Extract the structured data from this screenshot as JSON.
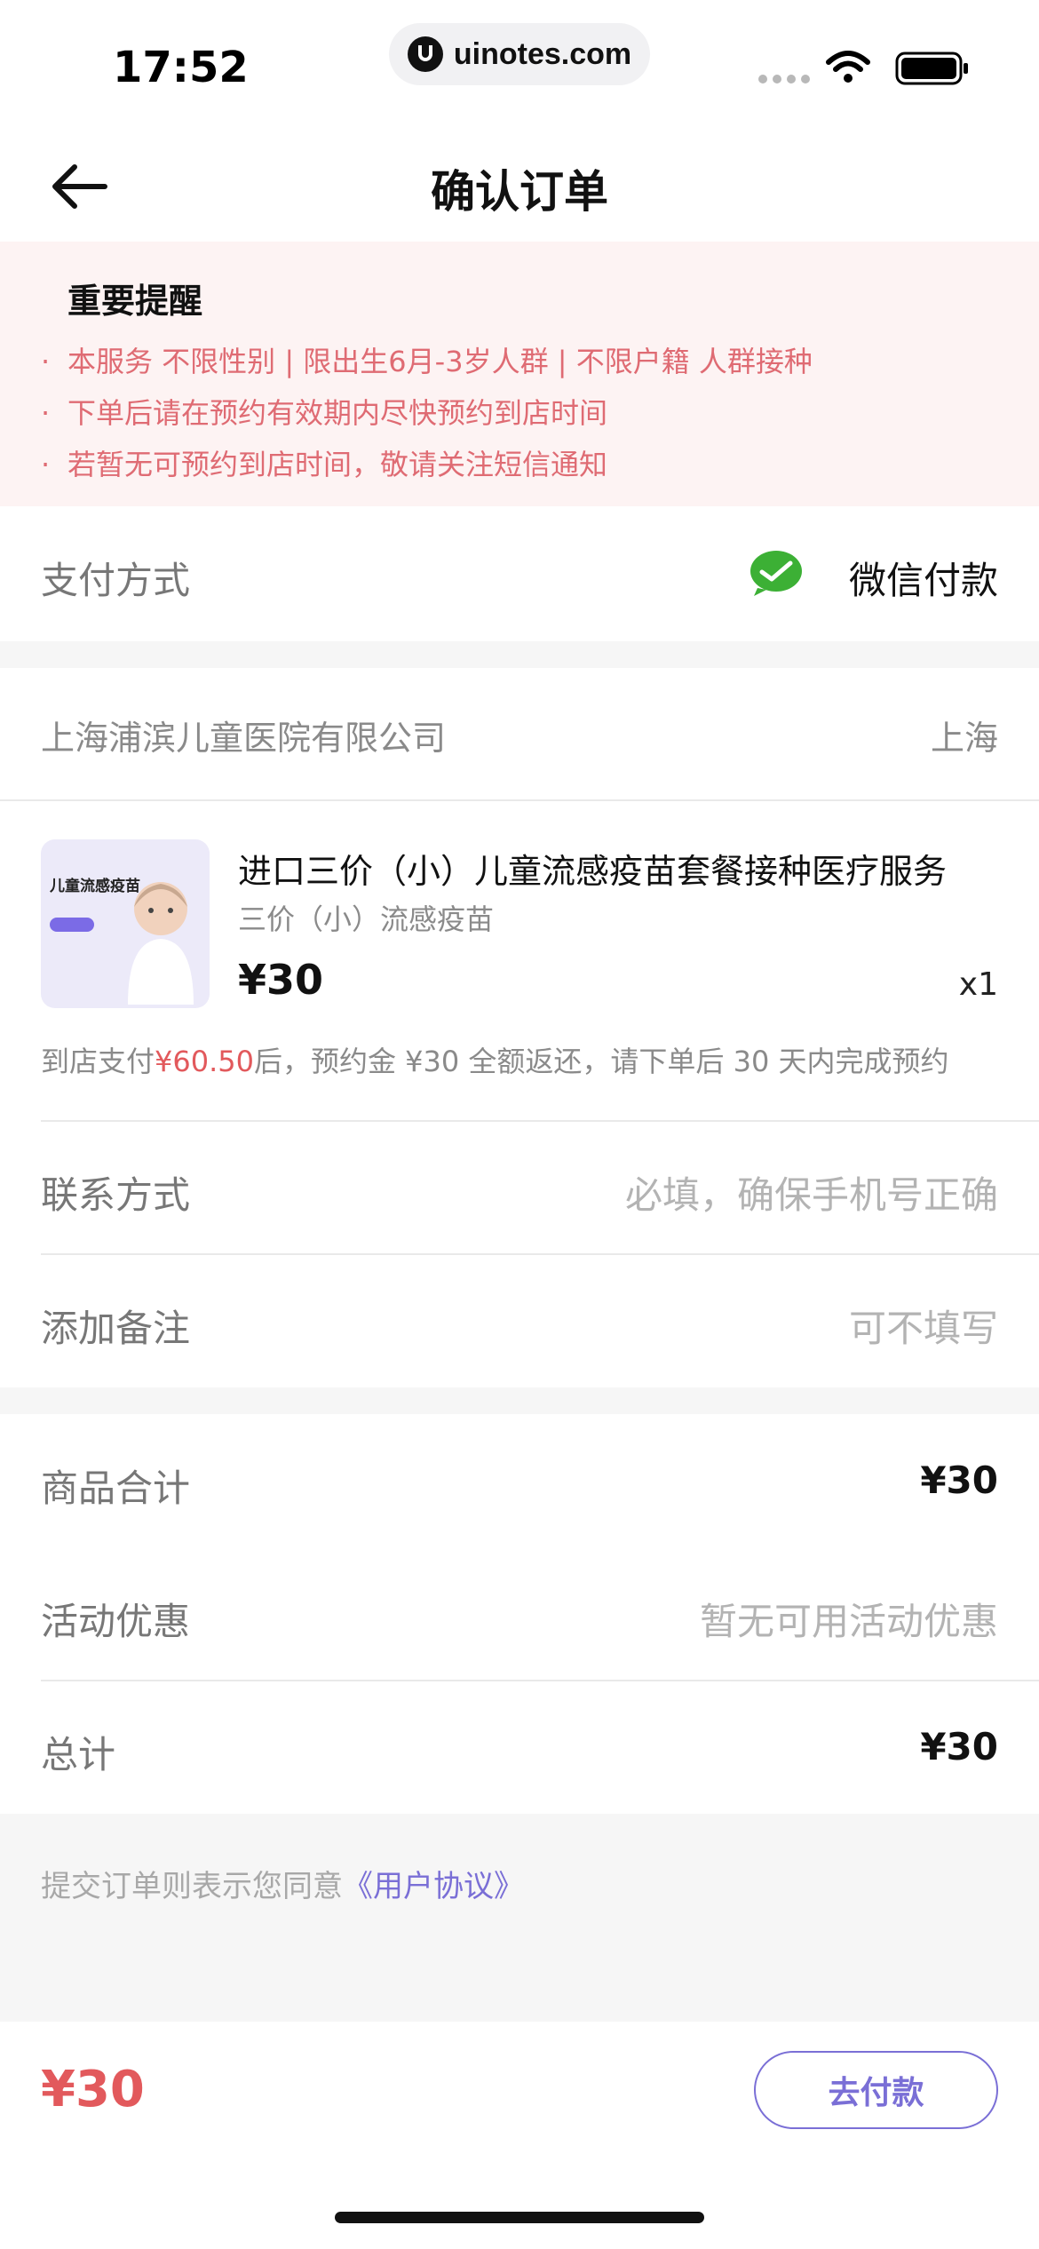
{
  "status_bar": {
    "time": "17:52",
    "url": "uinotes.com"
  },
  "nav": {
    "title": "确认订单",
    "back_icon": "arrow-left-icon"
  },
  "notice": {
    "title": "重要提醒",
    "lines": [
      "本服务 不限性别 | 限出生6月-3岁人群 | 不限户籍 人群接种",
      "下单后请在预约有效期内尽快预约到店时间",
      "若暂无可预约到店时间，敬请关注短信通知"
    ],
    "bullet": "·",
    "color": "#df6b73"
  },
  "payment": {
    "label": "支付方式",
    "method": "微信付款",
    "icon": "wechat-pay-icon"
  },
  "store": {
    "name": "上海浦滨儿童医院有限公司",
    "city": "上海"
  },
  "product": {
    "image_title": "儿童流感疫苗",
    "title": "进口三价（小）儿童流感疫苗套餐接种医疗服务",
    "subtitle": "三价（小）流感疫苗",
    "price": "¥30",
    "quantity": "x1",
    "note_prefix": "到店支付",
    "note_amount": "¥60.50",
    "note_suffix": "后，预约金 ¥30 全额返还，请下单后 30 天内完成预约"
  },
  "contact": {
    "label": "联系方式",
    "placeholder": "必填，确保手机号正确"
  },
  "remark": {
    "label": "添加备注",
    "placeholder": "可不填写"
  },
  "summary": {
    "subtotal_label": "商品合计",
    "subtotal": "¥30",
    "discount_label": "活动优惠",
    "discount": "暂无可用活动优惠",
    "total_label": "总计",
    "total": "¥30"
  },
  "agreement": {
    "text": "提交订单则表示您同意",
    "link": "《用户协议》"
  },
  "bottom": {
    "total": "¥30",
    "pay_label": "去付款"
  },
  "colors": {
    "accent": "#7a6fd6",
    "price_red": "#e2595c",
    "wechat_green": "#3cb035"
  }
}
